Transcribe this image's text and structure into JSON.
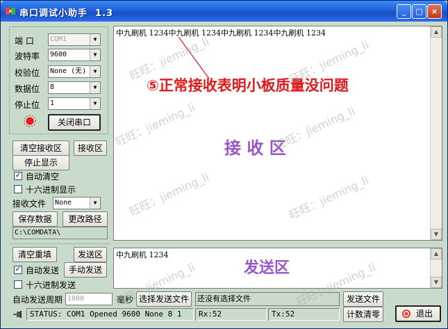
{
  "window": {
    "title": "串口调试小助手  1.3",
    "min": "_",
    "max": "□",
    "close": "×"
  },
  "settings": {
    "port_label": "端  口",
    "port_value": "COM1",
    "baud_label": "波特率",
    "baud_value": "9600",
    "parity_label": "校验位",
    "parity_value": "None (无)",
    "databits_label": "数据位",
    "databits_value": "8",
    "stopbits_label": "停止位",
    "stopbits_value": "1",
    "close_port_button": "关闭串口"
  },
  "receive": {
    "clear_button": "清空接收区",
    "area_button": "接收区",
    "stop_display_button": "停止显示",
    "auto_clear_label": "自动清空",
    "auto_clear_checked": true,
    "hex_display_label": "十六进制显示",
    "hex_display_checked": false,
    "file_label": "接收文件",
    "file_value": "None",
    "save_data_button": "保存数据",
    "change_path_button": "更改路径",
    "path_value": "C:\\COMDATA\\",
    "content": "中九刷机 1234中九刷机 1234中九刷机 1234中九刷机 1234",
    "annotation": "⑤正常接收表明小板质量没问题",
    "zone_label": "接 收 区"
  },
  "send": {
    "clear_resend_button": "清空重填",
    "area_button": "发送区",
    "auto_send_label": "自动发送",
    "auto_send_checked": true,
    "manual_send_button": "手动发送",
    "hex_send_label": "十六进制发送",
    "hex_send_checked": false,
    "period_label": "自动发送周期",
    "period_value": "1000",
    "ms_label": "毫秒",
    "select_file_button": "选择发送文件",
    "file_status": "还没有选择文件",
    "send_file_button": "发送文件",
    "content": "中九刷机 1234",
    "zone_label": "发送区"
  },
  "status": {
    "text": "STATUS: COM1 Opened 9600 None  8 1",
    "rx": "Rx:52",
    "tx": "Tx:52",
    "reset_count_button": "计数清零",
    "exit_button": "退出"
  },
  "watermark": "旺旺：jieming_li",
  "colors": {
    "accent_purple": "#9a55c8",
    "annotation_red": "#e0191a",
    "panel_green": "#c9dccb"
  }
}
